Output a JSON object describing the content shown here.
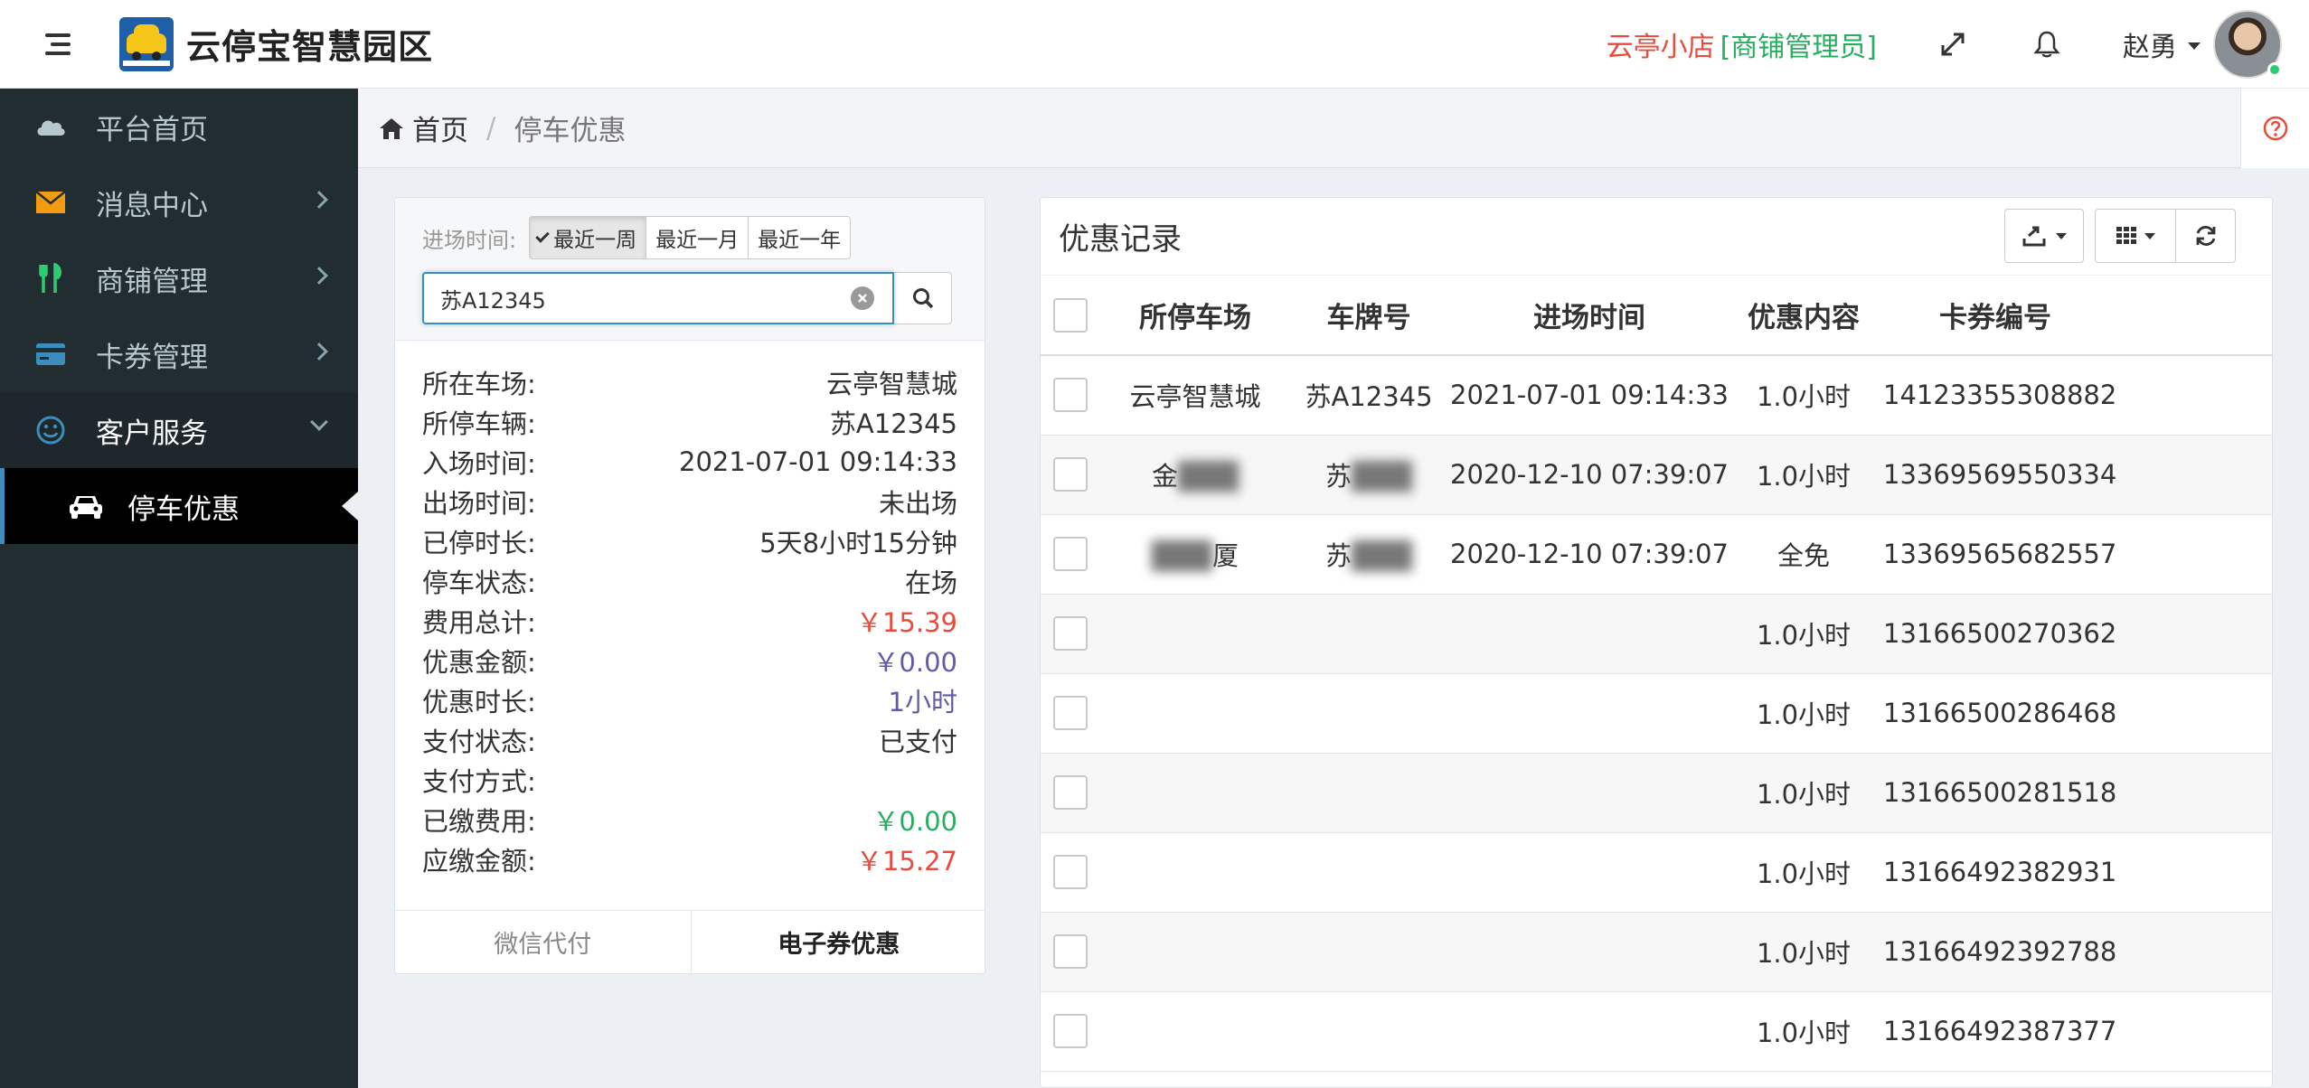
{
  "header": {
    "app_title": "云停宝智慧园区",
    "shop_name": "云亭小店",
    "shop_role": "[商铺管理员]",
    "user_name": "赵勇"
  },
  "sidebar": {
    "items": [
      {
        "label": "平台首页"
      },
      {
        "label": "消息中心"
      },
      {
        "label": "商铺管理"
      },
      {
        "label": "卡券管理"
      },
      {
        "label": "客户服务"
      }
    ],
    "sub_item": {
      "label": "停车优惠"
    }
  },
  "breadcrumb": {
    "home": "首页",
    "separator": "/",
    "current": "停车优惠"
  },
  "query": {
    "time_label": "进场时间:",
    "ranges": [
      "最近一周",
      "最近一月",
      "最近一年"
    ],
    "selected_range": "最近一周",
    "plate_value": "苏A12345"
  },
  "detail": {
    "rows": [
      {
        "k": "所在车场:",
        "v": "云亭智慧城"
      },
      {
        "k": "所停车辆:",
        "v": "苏A12345"
      },
      {
        "k": "入场时间:",
        "v": "2021-07-01 09:14:33"
      },
      {
        "k": "出场时间:",
        "v": "未出场"
      },
      {
        "k": "已停时长:",
        "v": "5天8小时15分钟"
      },
      {
        "k": "停车状态:",
        "v": "在场"
      },
      {
        "k": "费用总计:",
        "v": "￥15.39"
      },
      {
        "k": "优惠金额:",
        "v": "￥0.00"
      },
      {
        "k": "优惠时长:",
        "v": "1小时"
      },
      {
        "k": "支付状态:",
        "v": "已支付"
      },
      {
        "k": "支付方式:",
        "v": ""
      },
      {
        "k": "已缴费用:",
        "v": "￥0.00"
      },
      {
        "k": "应缴金额:",
        "v": "￥15.27"
      }
    ],
    "wechat_btn": "微信代付",
    "coupon_btn": "电子券优惠"
  },
  "records": {
    "title": "优惠记录",
    "columns": [
      "所停车场",
      "车牌号",
      "进场时间",
      "优惠内容",
      "卡券编号"
    ],
    "rows": [
      {
        "lot": "云亭智慧城",
        "plate": "苏A12345",
        "time": "2021-07-01 09:14:33",
        "benefit": "1.0小时",
        "card": "14123355308882"
      },
      {
        "lot": "金",
        "plate": "苏",
        "time": "2020-12-10 07:39:07",
        "benefit": "1.0小时",
        "card": "13369569550334"
      },
      {
        "lot": "厦",
        "plate": "苏",
        "time": "2020-12-10 07:39:07",
        "benefit": "全免",
        "card": "13369565682557"
      },
      {
        "lot": "",
        "plate": "",
        "time": "",
        "benefit": "1.0小时",
        "card": "13166500270362"
      },
      {
        "lot": "",
        "plate": "",
        "time": "",
        "benefit": "1.0小时",
        "card": "13166500286468"
      },
      {
        "lot": "",
        "plate": "",
        "time": "",
        "benefit": "1.0小时",
        "card": "13166500281518"
      },
      {
        "lot": "",
        "plate": "",
        "time": "",
        "benefit": "1.0小时",
        "card": "13166492382931"
      },
      {
        "lot": "",
        "plate": "",
        "time": "",
        "benefit": "1.0小时",
        "card": "13166492392788"
      },
      {
        "lot": "",
        "plate": "",
        "time": "",
        "benefit": "1.0小时",
        "card": "13166492387377"
      }
    ]
  },
  "colors": {
    "sidebar_bg": "#222d32",
    "accent": "#3c8dbc",
    "red": "#e74c3c",
    "green": "#27ae60",
    "purple": "#605ca8"
  },
  "icons": {
    "menu": "hamburger-icon",
    "fullscreen": "expand-icon",
    "notify": "bell-icon",
    "help": "question-circle-icon"
  }
}
